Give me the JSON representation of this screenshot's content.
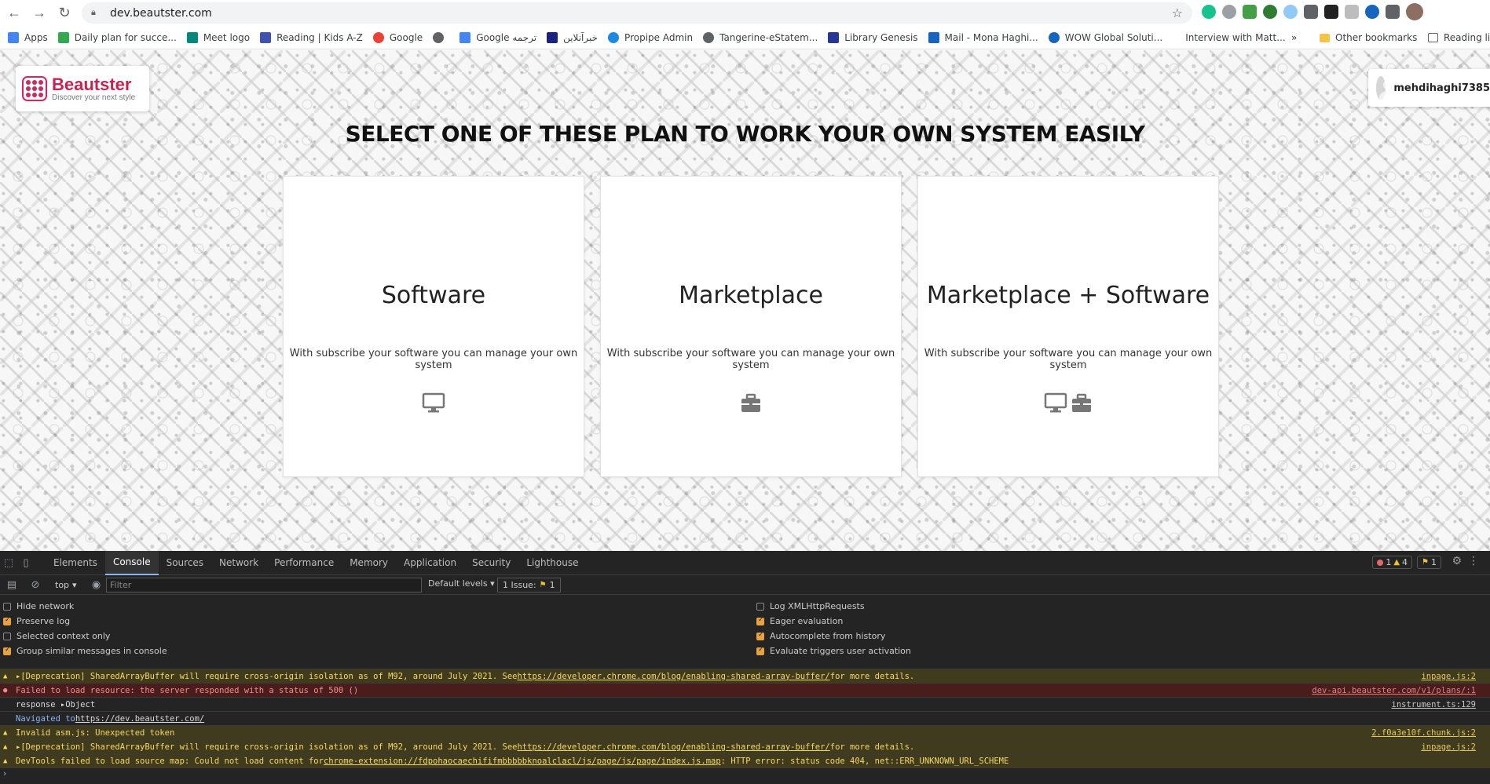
{
  "browser": {
    "url": "dev.beautster.com",
    "bookmarks": [
      {
        "label": "Apps",
        "color": "#4285f4"
      },
      {
        "label": "Daily plan for succe...",
        "color": "#34a853"
      },
      {
        "label": "Meet logo",
        "color": "#00897b"
      },
      {
        "label": "Reading | Kids A-Z",
        "color": "#3f51b5"
      },
      {
        "label": "Google",
        "color": "#ea4335"
      },
      {
        "label": "",
        "color": "#5f6368"
      },
      {
        "label": "Google ترجمه",
        "color": "#4285f4"
      },
      {
        "label": "خبرآنلاین",
        "color": "#1a237e"
      },
      {
        "label": "Propipe Admin",
        "color": "#1e88e5"
      },
      {
        "label": "Tangerine-eStatem...",
        "color": "#5f6368"
      },
      {
        "label": "Library Genesis",
        "color": "#283593"
      },
      {
        "label": "Mail - Mona Haghi...",
        "color": "#1565c0"
      },
      {
        "label": "WOW Global Soluti...",
        "color": "#1565c0"
      },
      {
        "label": "Interview with Matt...",
        "color": ""
      }
    ],
    "other_bookmarks": "Other bookmarks",
    "reading_list": "Reading list",
    "more_chevron": "»"
  },
  "page": {
    "logo_name": "Beautster",
    "logo_tagline": "Discover your next style",
    "username": "mehdihaghi7385",
    "title": "SELECT ONE OF THESE PLAN TO WORK YOUR OWN SYSTEM EASILY",
    "plans": [
      {
        "title": "Software",
        "description": "With subscribe your software you can manage your own system",
        "icon": "monitor-icon"
      },
      {
        "title": "Marketplace",
        "description": "With subscribe your software you can manage your own system",
        "icon": "briefcase-icon"
      },
      {
        "title": "Marketplace + Software",
        "description": "With subscribe your software you can manage your own system",
        "icon": "monitor-briefcase-icon"
      }
    ]
  },
  "devtools": {
    "tabs": [
      "Elements",
      "Console",
      "Sources",
      "Network",
      "Performance",
      "Memory",
      "Application",
      "Security",
      "Lighthouse"
    ],
    "active_tab": "Console",
    "errors_count": "1",
    "warnings_count": "4",
    "issues_badge": "1",
    "context": "top",
    "filter_placeholder": "Filter",
    "levels": "Default levels",
    "issues_label": "1 Issue:",
    "issues_count": "1",
    "settings_left": [
      {
        "label": "Hide network",
        "checked": false
      },
      {
        "label": "Preserve log",
        "checked": true
      },
      {
        "label": "Selected context only",
        "checked": false
      },
      {
        "label": "Group similar messages in console",
        "checked": true
      }
    ],
    "settings_right": [
      {
        "label": "Log XMLHttpRequests",
        "checked": false
      },
      {
        "label": "Eager evaluation",
        "checked": true
      },
      {
        "label": "Autocomplete from history",
        "checked": true
      },
      {
        "label": "Evaluate triggers user activation",
        "checked": true
      }
    ],
    "logs": [
      {
        "level": "warn",
        "pre": "▸[Deprecation] SharedArrayBuffer will require cross-origin isolation as of M92, around July 2021. See ",
        "link": "https://developer.chrome.com/blog/enabling-shared-array-buffer/",
        "post": " for more details.",
        "source": "inpage.js:2"
      },
      {
        "level": "err",
        "pre": "Failed to load resource: the server responded with a status of 500 ()",
        "link": "",
        "post": "",
        "source": "dev-api.beautster.com/v1/plans/:1"
      },
      {
        "level": "info",
        "pre": "response ▸Object",
        "link": "",
        "post": "",
        "source": "instrument.ts:129"
      },
      {
        "level": "nav",
        "pre": "Navigated to ",
        "link": "https://dev.beautster.com/",
        "post": "",
        "source": ""
      },
      {
        "level": "warn",
        "pre": "Invalid asm.js: Unexpected token",
        "link": "",
        "post": "",
        "source": "2.f0a3e10f.chunk.js:2"
      },
      {
        "level": "warn",
        "pre": "▸[Deprecation] SharedArrayBuffer will require cross-origin isolation as of M92, around July 2021. See ",
        "link": "https://developer.chrome.com/blog/enabling-shared-array-buffer/",
        "post": " for more details.",
        "source": "inpage.js:2"
      },
      {
        "level": "warn",
        "pre": "DevTools failed to load source map: Could not load content for ",
        "link": "chrome-extension://fdpohaocaechififmbbbbbknoalclacl/js/page/js/page/index.js.map",
        "post": ": HTTP error: status code 404, net::ERR_UNKNOWN_URL_SCHEME",
        "source": ""
      }
    ]
  }
}
